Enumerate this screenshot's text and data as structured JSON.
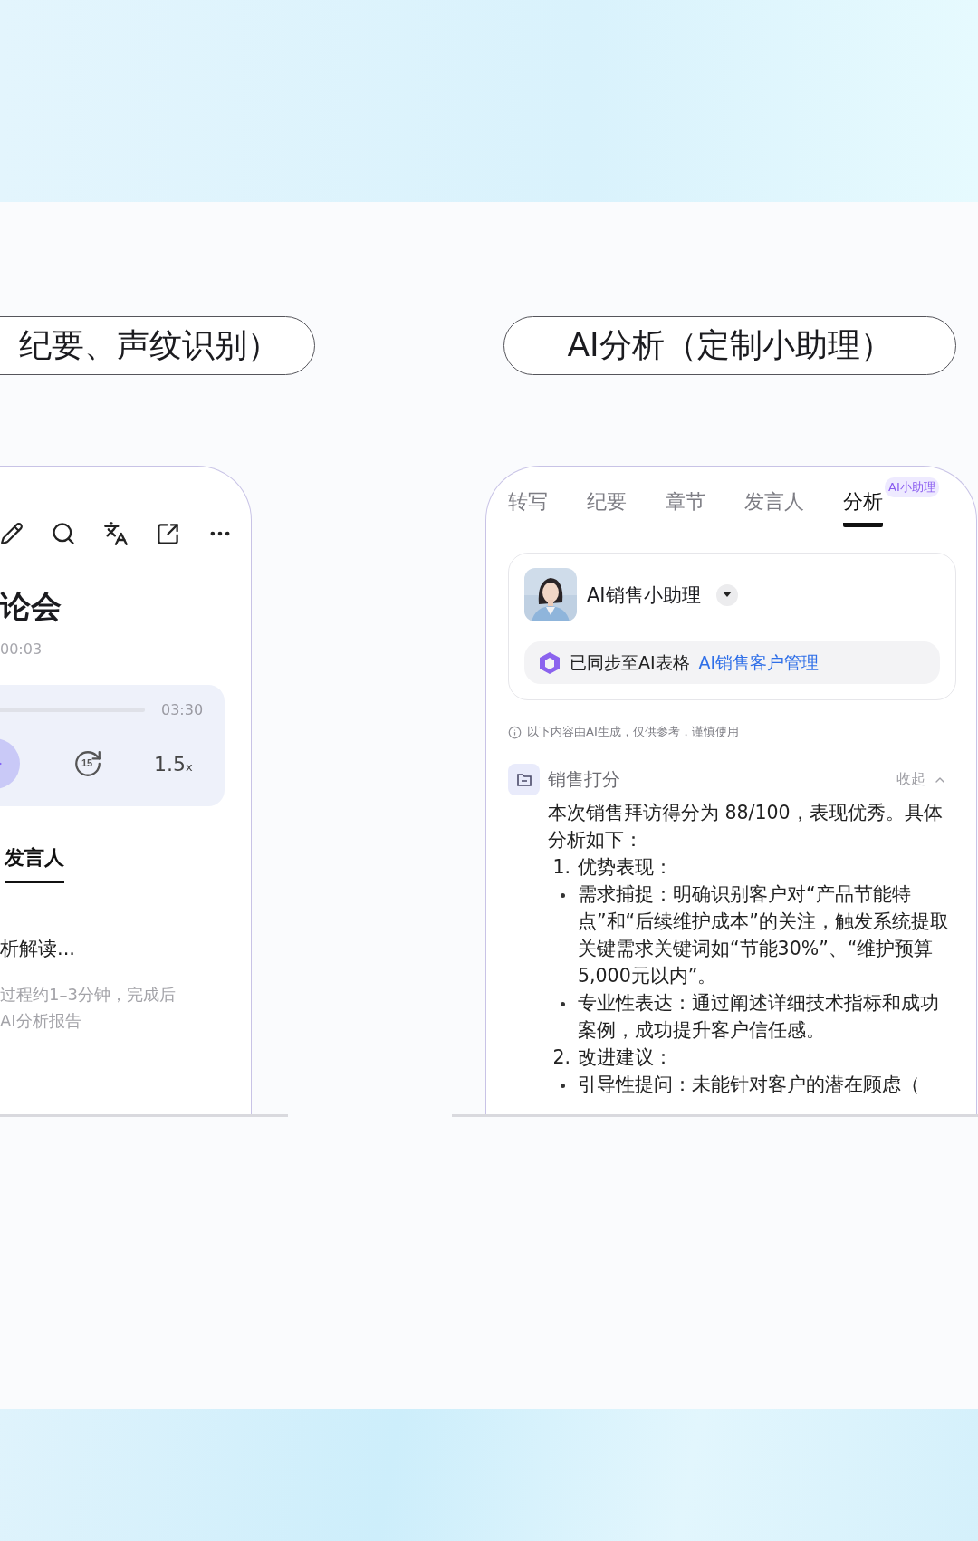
{
  "pills": [
    {
      "text": "纪要、声纹识别）"
    },
    {
      "text": "AI分析（定制小助理）"
    }
  ],
  "left_phone": {
    "title": "论会",
    "time": "00:03",
    "player": {
      "duration": "03:30",
      "skip_label": "15",
      "speed": "1.5",
      "speed_unit": "x"
    },
    "tab": {
      "label": "发言人",
      "selected": true
    },
    "status": "析解读...",
    "note_lines": [
      "过程约1–3分钟，完成后",
      "AI分析报告"
    ]
  },
  "right_phone": {
    "tabs": [
      {
        "label": "转写",
        "selected": false
      },
      {
        "label": "纪要",
        "selected": false
      },
      {
        "label": "章节",
        "selected": false
      },
      {
        "label": "发言人",
        "selected": false
      },
      {
        "label": "分析",
        "selected": true,
        "badge": "AI小助理"
      }
    ],
    "assistant": {
      "name": "AI销售小助理",
      "sync_text": "已同步至AI表格",
      "sync_link": "AI销售客户管理"
    },
    "disclaimer": "以下内容由AI生成，仅供参考，谨慎使用",
    "section": {
      "title": "销售打分",
      "toggle": "收起",
      "expanded": true,
      "content": [
        {
          "kind": "para",
          "text": "本次销售拜访得分为 88/100，表现优秀。具体分析如下："
        },
        {
          "kind": "numbered",
          "number": "1.",
          "text": "优势表现："
        },
        {
          "kind": "bullet",
          "text": "需求捕捉：明确识别客户对“产品节能特点”和“后续维护成本”的关注，触发系统提取关键需求关键词如“节能30%”、“维护预算5,000元以内”。"
        },
        {
          "kind": "bullet",
          "text": "专业性表达：通过阐述详细技术指标和成功案例，成功提升客户信任感。"
        },
        {
          "kind": "numbered",
          "number": "2.",
          "text": "改进建议："
        },
        {
          "kind": "bullet",
          "text": "引导性提问：未能针对客户的潜在顾虑（"
        }
      ]
    }
  }
}
